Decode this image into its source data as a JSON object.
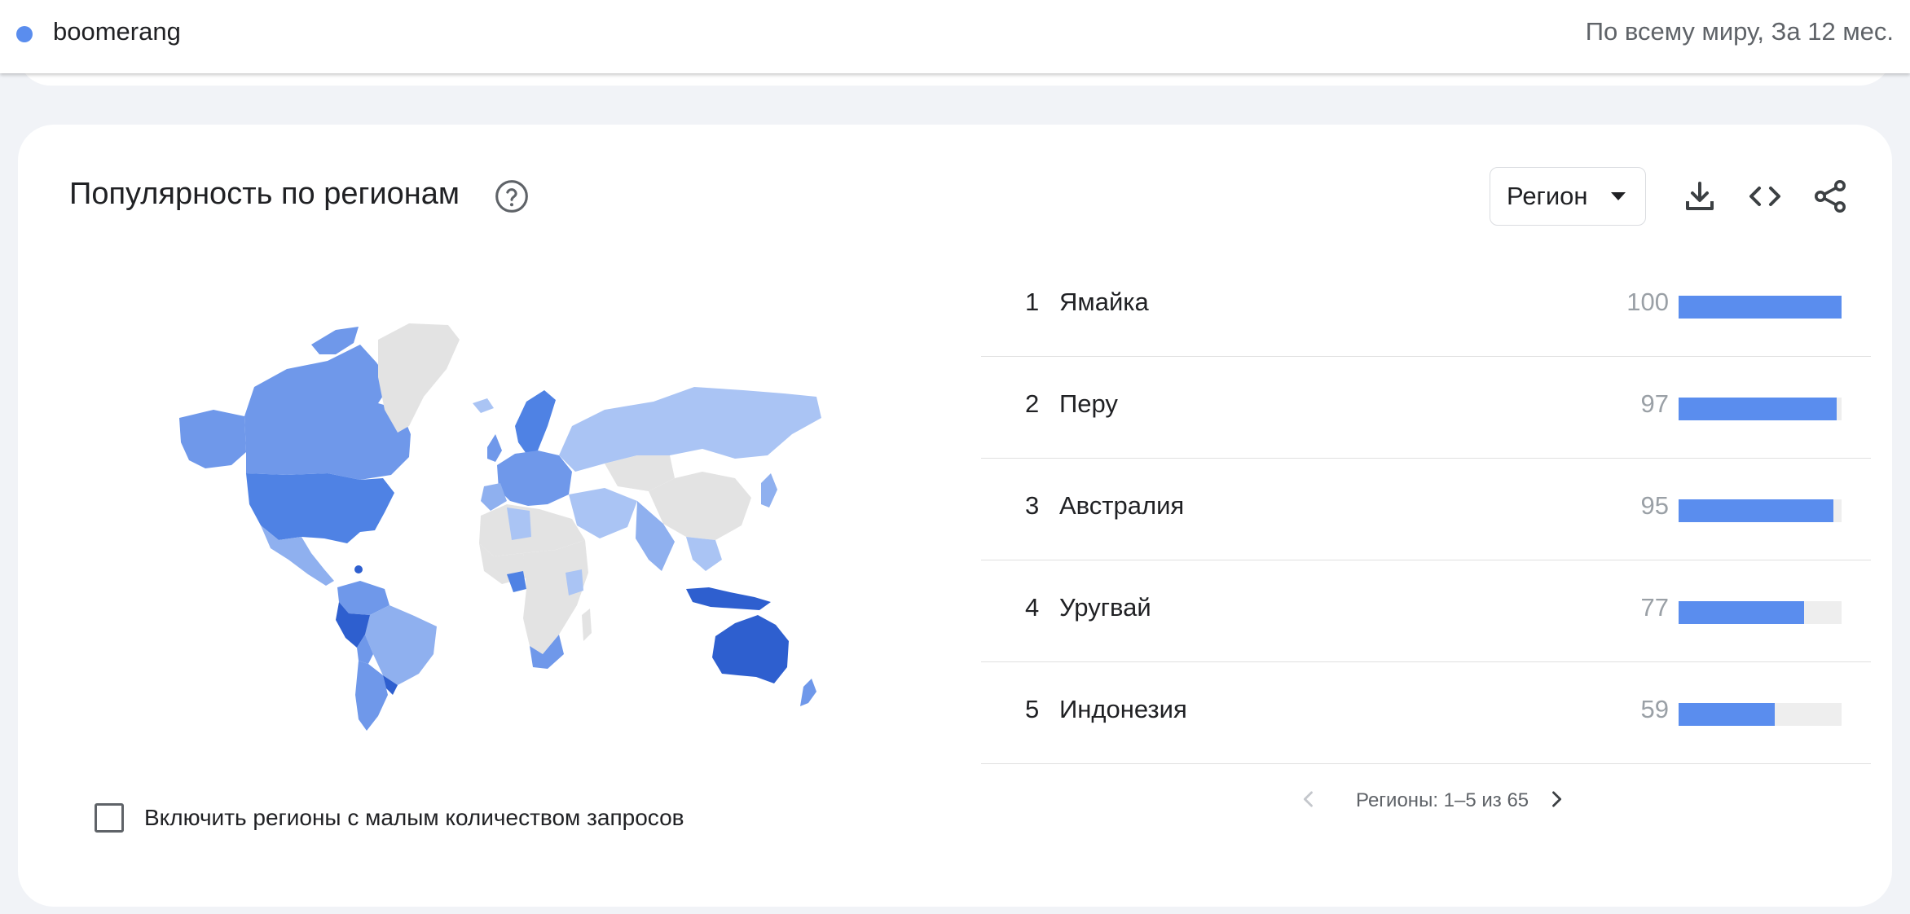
{
  "header": {
    "term": "boomerang",
    "term_color": "#5a8dee",
    "scope": "По всему миру, За 12 мес."
  },
  "card": {
    "title": "Популярность по регионам",
    "help_icon": "help-circle-icon",
    "resolution_select": "Регион",
    "actions": [
      "download-icon",
      "embed-code-icon",
      "share-icon"
    ]
  },
  "map": {
    "legend_scale_colors": [
      "#e3e3e3",
      "#aac4f4",
      "#8fb0ef",
      "#6f98ea",
      "#4f82e4",
      "#2e5fcf"
    ]
  },
  "ranking": {
    "rows": [
      {
        "rank": "1",
        "name": "Ямайка",
        "value": "100",
        "fraction": 1.0
      },
      {
        "rank": "2",
        "name": "Перу",
        "value": "97",
        "fraction": 0.97
      },
      {
        "rank": "3",
        "name": "Австралия",
        "value": "95",
        "fraction": 0.95
      },
      {
        "rank": "4",
        "name": "Уругвай",
        "value": "77",
        "fraction": 0.77
      },
      {
        "rank": "5",
        "name": "Индонезия",
        "value": "59",
        "fraction": 0.59
      }
    ],
    "pager_text": "Регионы: 1–5 из 65"
  },
  "low_volume_checkbox": {
    "label": "Включить регионы с малым количеством запросов",
    "checked": false
  },
  "colors": {
    "accent": "#5a8dee",
    "bar_track": "#eeeeee"
  }
}
